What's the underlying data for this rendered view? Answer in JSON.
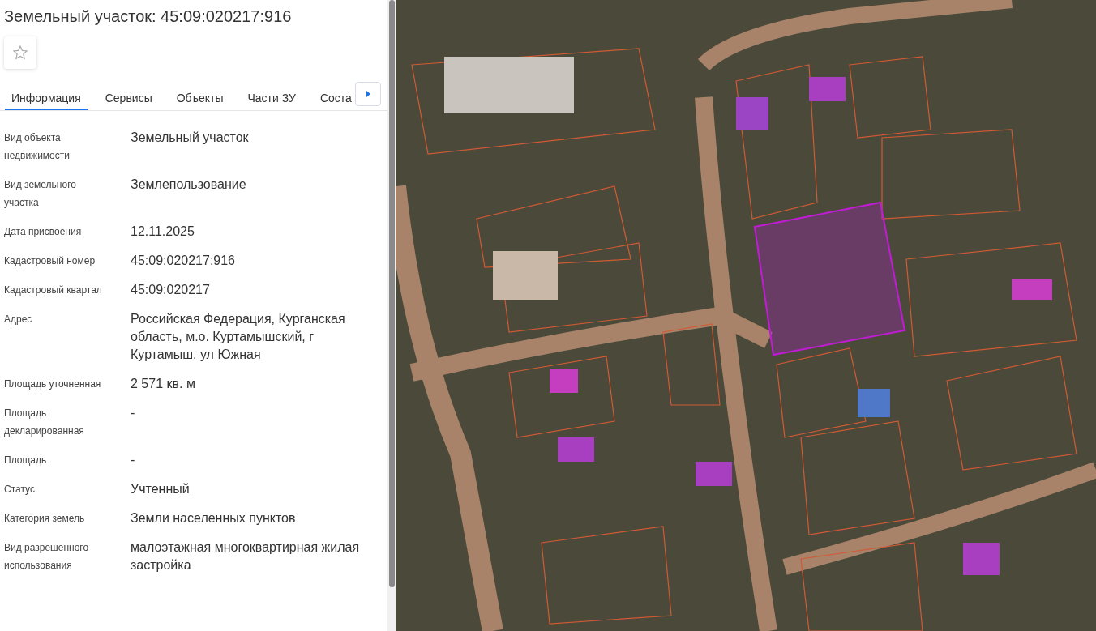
{
  "title": "Земельный участок: 45:09:020217:916",
  "favorite": {
    "on": false
  },
  "tabs": [
    {
      "label": "Информация",
      "selected": true
    },
    {
      "label": "Сервисы",
      "selected": false
    },
    {
      "label": "Объекты",
      "selected": false
    },
    {
      "label": "Части ЗУ",
      "selected": false
    },
    {
      "label": "Соста",
      "selected": false
    }
  ],
  "fields": [
    {
      "label": "Вид объекта недвижимости",
      "value": "Земельный участок"
    },
    {
      "label": "Вид земельного участка",
      "value": "Землепользование"
    },
    {
      "label": "Дата присвоения",
      "value": "12.11.2025"
    },
    {
      "label": "Кадастровый номер",
      "value": "45:09:020217:916"
    },
    {
      "label": "Кадастровый квартал",
      "value": "45:09:020217"
    },
    {
      "label": "Адрес",
      "value": "Российская Федерация, Курганская область, м.о. Куртамышский, г Куртамыш, ул Южная"
    },
    {
      "label": "Площадь уточненная",
      "value": "2 571 кв. м"
    },
    {
      "label": "Площадь декларированная",
      "value": "-"
    },
    {
      "label": "Площадь",
      "value": "-"
    },
    {
      "label": "Статус",
      "value": "Учтенный"
    },
    {
      "label": "Категория земель",
      "value": "Земли населенных пунктов"
    },
    {
      "label": "Вид разрешенного использования",
      "value": "малоэтажная многоквартирная жилая застройка"
    }
  ]
}
